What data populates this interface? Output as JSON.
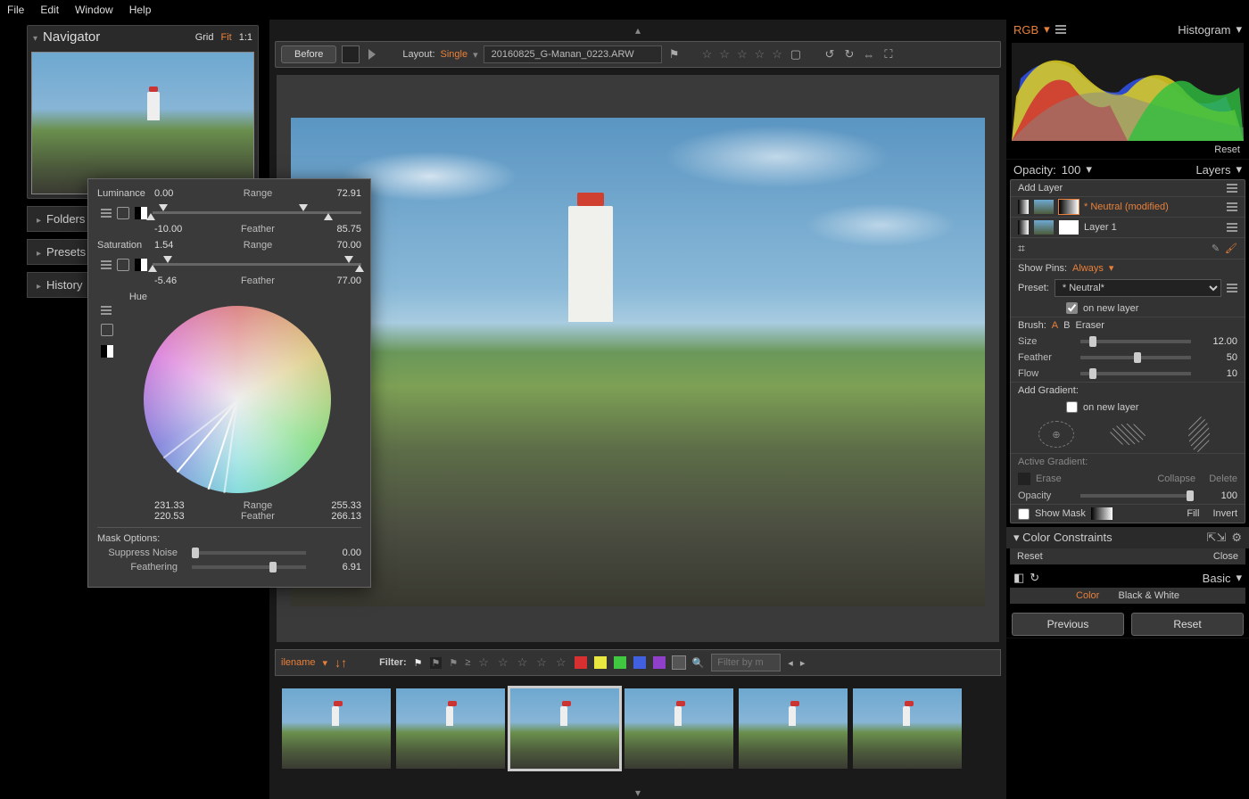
{
  "menu": {
    "file": "File",
    "edit": "Edit",
    "window": "Window",
    "help": "Help"
  },
  "navigator": {
    "title": "Navigator",
    "grid": "Grid",
    "fit": "Fit",
    "oneToOne": "1:1",
    "sections": {
      "folders": "Folders",
      "presets": "Presets",
      "history": "History"
    }
  },
  "toolbar": {
    "before": "Before",
    "layoutLabel": "Layout:",
    "layoutValue": "Single",
    "filename": "20160825_G-Manan_0223.ARW"
  },
  "filmstripBar": {
    "ilename": "ilename",
    "filterLabel": "Filter:",
    "filterPlaceholder": "Filter by m",
    "swatches": [
      "#d83030",
      "#e8e840",
      "#40c840",
      "#4060e0",
      "#9040c8",
      "#888888"
    ]
  },
  "histogram": {
    "mode": "RGB",
    "title": "Histogram",
    "reset": "Reset"
  },
  "layers": {
    "title": "Layers",
    "opacityLabel": "Opacity:",
    "opacityValue": "100",
    "addLayer": "Add Layer",
    "item1": "* Neutral (modified)",
    "item2": "Layer 1",
    "showPins": "Show Pins:",
    "showPinsValue": "Always",
    "presetLabel": "Preset:",
    "presetValue": "* Neutral*",
    "onNewLayer": "on new layer",
    "brushLabel": "Brush:",
    "brushA": "A",
    "brushB": "B",
    "brushEraser": "Eraser",
    "size": "Size",
    "sizeVal": "12.00",
    "feather": "Feather",
    "featherVal": "50",
    "flow": "Flow",
    "flowVal": "10",
    "addGradient": "Add Gradient:",
    "activeGradient": "Active Gradient:",
    "erase": "Erase",
    "collapse": "Collapse",
    "delete": "Delete",
    "opacity2": "Opacity",
    "opacity2Val": "100",
    "showMask": "Show Mask",
    "fill": "Fill",
    "invert": "Invert"
  },
  "colorConstraints": {
    "title": "Color Constraints",
    "reset": "Reset",
    "close": "Close"
  },
  "basic": {
    "title": "Basic",
    "color": "Color",
    "bw": "Black & White"
  },
  "footer": {
    "previous": "Previous",
    "reset": "Reset"
  },
  "floatPanel": {
    "luminance": {
      "label": "Luminance",
      "rangeLabel": "Range",
      "featherLabel": "Feather",
      "low": "0.00",
      "high": "72.91",
      "flow": "-10.00",
      "fhigh": "85.75"
    },
    "saturation": {
      "label": "Saturation",
      "rangeLabel": "Range",
      "featherLabel": "Feather",
      "low": "1.54",
      "high": "70.00",
      "flow": "-5.46",
      "fhigh": "77.00"
    },
    "hue": {
      "label": "Hue",
      "rangeLabel": "Range",
      "featherLabel": "Feather",
      "low": "231.33",
      "high": "255.33",
      "flow": "220.53",
      "fhigh": "266.13"
    },
    "maskOptions": "Mask Options:",
    "suppressNoise": "Suppress Noise",
    "suppressNoiseVal": "0.00",
    "feathering": "Feathering",
    "featheringVal": "6.91"
  }
}
